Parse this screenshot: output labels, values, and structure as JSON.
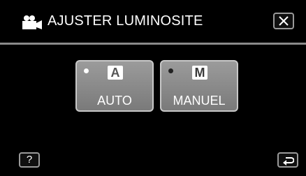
{
  "header": {
    "title": "AJUSTER LUMINOSITE",
    "icon": "video-camera-icon",
    "close_icon": "close-icon"
  },
  "modes": [
    {
      "glyph": "A",
      "label": "AUTO",
      "selected": true
    },
    {
      "glyph": "M",
      "label": "MANUEL",
      "selected": false
    }
  ],
  "footer": {
    "help_label": "?",
    "back_icon": "return-icon"
  },
  "colors": {
    "background": "#000000",
    "button_face": "#8c8c8c",
    "border": "#c8c8c8",
    "text": "#ffffff"
  }
}
